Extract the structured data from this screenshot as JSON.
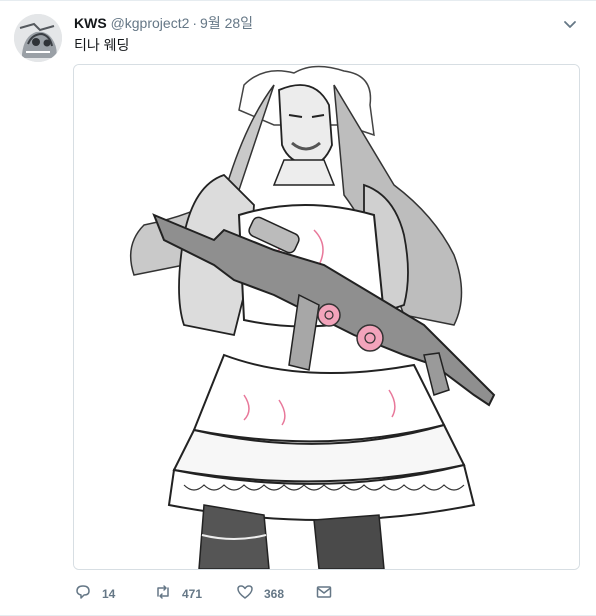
{
  "tweet": {
    "author_name": "KWS",
    "handle": "@kgproject2",
    "separator": "·",
    "date": "9월 28일",
    "text": "티나 웨딩",
    "avatar": "monochrome sketch avatar",
    "menu_icon": "chevron-down-icon"
  },
  "actions": {
    "reply": {
      "icon": "reply-icon",
      "count": "14"
    },
    "retweet": {
      "icon": "retweet-icon",
      "count": "471"
    },
    "like": {
      "icon": "heart-icon",
      "count": "368"
    },
    "message": {
      "icon": "envelope-icon"
    }
  },
  "colors": {
    "text": "#14171a",
    "secondary": "#657786",
    "border": "#e6ecf0",
    "icon": "#657786",
    "rose": "#e8789a"
  }
}
